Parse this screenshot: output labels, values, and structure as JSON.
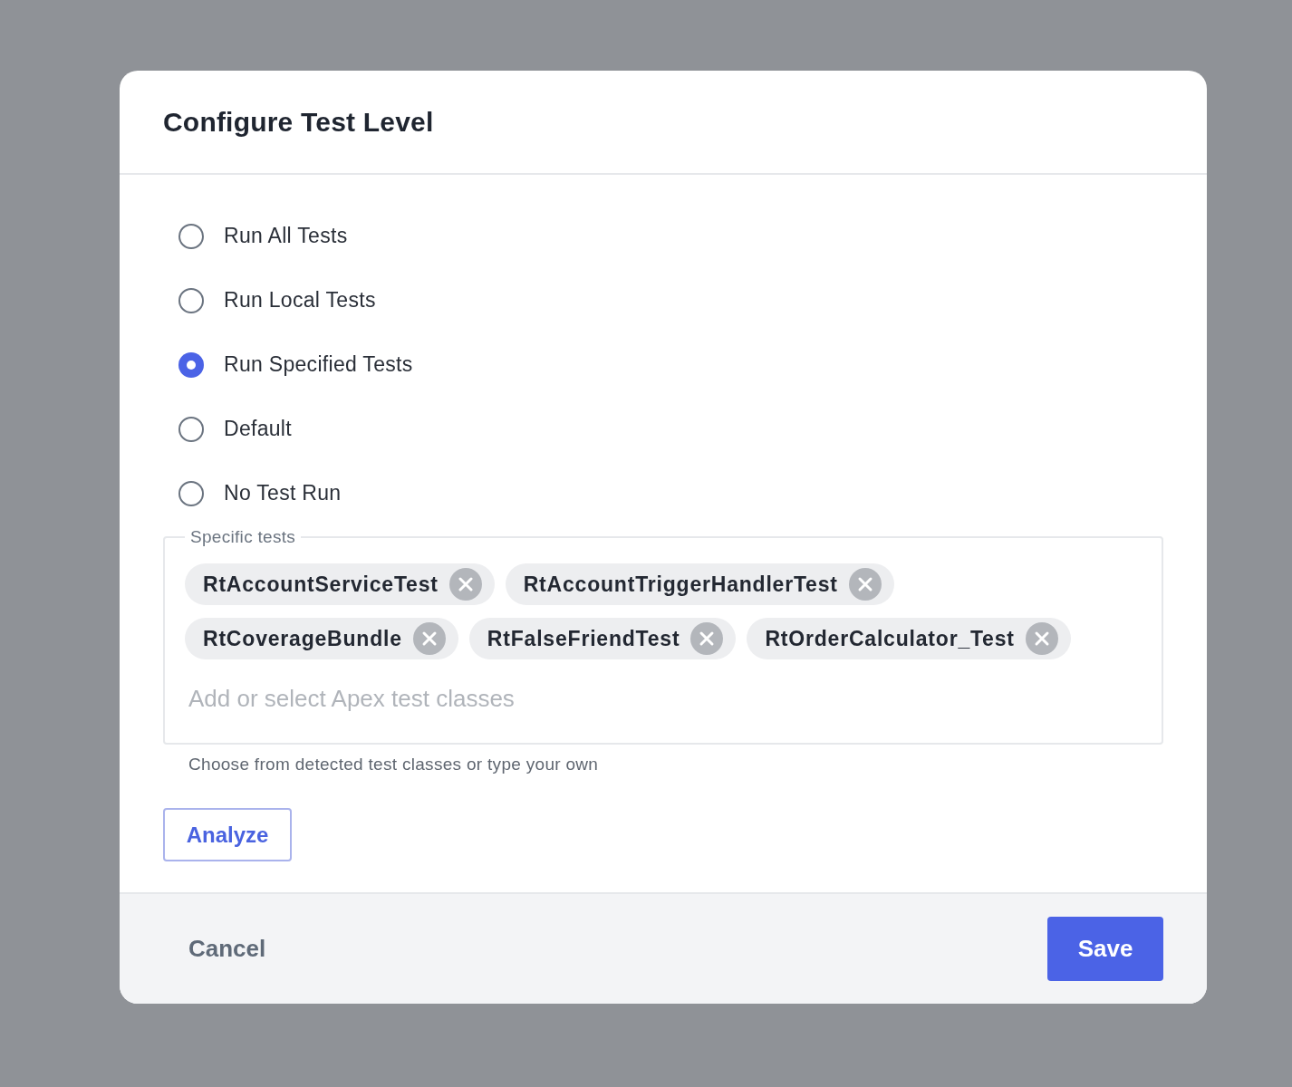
{
  "dialog": {
    "title": "Configure Test Level",
    "options": [
      {
        "label": "Run All Tests",
        "selected": false
      },
      {
        "label": "Run Local Tests",
        "selected": false
      },
      {
        "label": "Run Specified Tests",
        "selected": true
      },
      {
        "label": "Default",
        "selected": false
      },
      {
        "label": "No Test Run",
        "selected": false
      }
    ],
    "specific_tests": {
      "legend": "Specific tests",
      "chips": [
        {
          "label": "RtAccountServiceTest"
        },
        {
          "label": "RtAccountTriggerHandlerTest"
        },
        {
          "label": "RtCoverageBundle"
        },
        {
          "label": "RtFalseFriendTest"
        },
        {
          "label": "RtOrderCalculator_Test"
        }
      ],
      "placeholder": "Add or select Apex test classes",
      "hint": "Choose from detected test classes or type your own"
    },
    "analyze_button": "Analyze",
    "footer_buttons": [
      {
        "label": "Cancel",
        "kind": "text"
      },
      {
        "label": "Save",
        "kind": "primary"
      }
    ]
  }
}
